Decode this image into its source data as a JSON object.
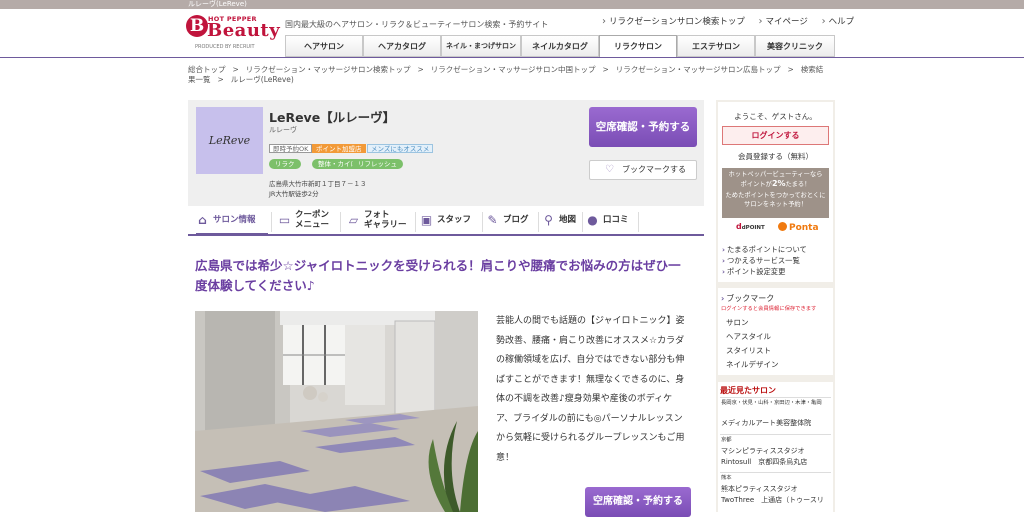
{
  "header": {
    "window_title": "ルレーヴ(LeReve)",
    "logo_small": "HOT PEPPER",
    "logo_main": "Beauty",
    "logo_sub": "PRODUCED BY RECRUIT",
    "tagline": "国内最大級のヘアサロン・リラク＆ビューティーサロン検索・予約サイト",
    "links": [
      "リラクゼーションサロン検索トップ",
      "マイページ",
      "ヘルプ"
    ]
  },
  "global_nav": {
    "tabs": [
      "ヘアサロン",
      "ヘアカタログ",
      "ネイル・まつげサロン",
      "ネイルカタログ",
      "リラクサロン",
      "エステサロン",
      "美容クリニック"
    ],
    "active": "リラクサロン"
  },
  "breadcrumb": [
    "総合トップ",
    "リラクゼーション・マッサージサロン検索トップ",
    "リラクゼーション・マッサージサロン中国トップ",
    "リラクゼーション・マッサージサロン広島トップ",
    "検索結果一覧",
    "ルレーヴ(LeReve)"
  ],
  "salon": {
    "image_text": "LeReve",
    "name": "LeReve【ルレーヴ】",
    "kana": "ルレーヴ",
    "badges": [
      "即時予約OK",
      "ポイント加盟店",
      "メンズにもオススメ"
    ],
    "categories": [
      "リラク",
      "整体・カイロ",
      "リフレッシュ"
    ],
    "address_line1": "広島県大竹市新町１丁目７－１３",
    "address_line2": "JR大竹駅徒歩2分",
    "reserve_label": "空席確認・予約する",
    "bookmark_label": "ブックマークする"
  },
  "salon_nav": [
    {
      "icon": "home-icon",
      "label": "サロン情報",
      "active": true
    },
    {
      "icon": "coupon-icon",
      "label": "クーポン\nメニュー"
    },
    {
      "icon": "photo-icon",
      "label": "フォト\nギャラリー"
    },
    {
      "icon": "staff-icon",
      "label": "スタッフ"
    },
    {
      "icon": "pen-icon",
      "label": "ブログ"
    },
    {
      "icon": "map-pin-icon",
      "label": "地図"
    },
    {
      "icon": "chat-icon",
      "label": "口コミ"
    }
  ],
  "main": {
    "catch": "広島県では希少☆ジャイロトニックを受けられる！肩こりや腰痛でお悩みの方はぜひ一度体験してください♪",
    "description": "芸能人の間でも話題の【ジャイロトニック】姿勢改善、腰痛・肩こり改善にオススメ☆カラダの稼働領域を広げ、自分ではできない部分も伸ばすことができます！無理なくできるのに、身体の不調を改善♪瘦身効果や産後のボディケア、ブライダルの前にも◎パーソナルレッスンから気軽に受けられるグループレッスンもご用意！",
    "reserve_label": "空席確認・予約する"
  },
  "sidebar": {
    "welcome": "ようこそ、ゲストさん。",
    "login": "ログインする",
    "register": "会員登録する（無料）",
    "point_line1": "ホットペッパービューティーなら",
    "point_line2a": "ポイントが",
    "point_pct": "2%",
    "point_line2b": "たまる！",
    "point_line3": "ためたポイントをつかっておとくに",
    "point_line4": "サロンをネット予約！",
    "dpoint": "dPOINT",
    "ponta": "Ponta",
    "point_links": [
      "たまるポイントについて",
      "つかえるサービス一覧",
      "ポイント設定変更"
    ],
    "bookmark_title": "ブックマーク",
    "bookmark_note": "ログインすると会員情報に保存できます",
    "bookmark_items": [
      "サロン",
      "ヘアスタイル",
      "スタイリスト",
      "ネイルデザイン"
    ],
    "recent_title": "最近見たサロン",
    "recent": [
      {
        "area": "長岡京・伏見・山科・京田辺・木津・亀岡",
        "name": "メディカルアート美容整体院"
      },
      {
        "area": "京都",
        "name": "マシンピラティススタジオ",
        "name2": "Rintosull　京都四条烏丸店"
      },
      {
        "area": "熊本",
        "name": "熊本ピラティススタジオ",
        "name2": "TwoThree　上通店（トゥースリ"
      }
    ]
  }
}
